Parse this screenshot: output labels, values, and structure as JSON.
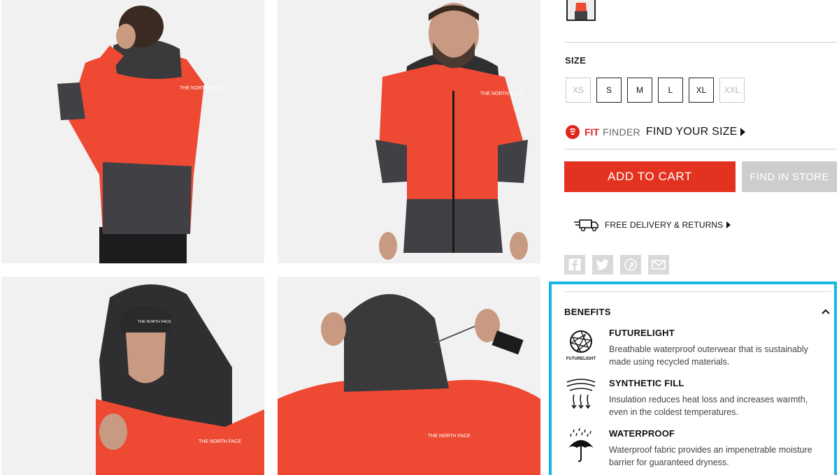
{
  "size": {
    "heading": "SIZE",
    "options": [
      {
        "label": "XS",
        "available": false
      },
      {
        "label": "S",
        "available": true
      },
      {
        "label": "M",
        "available": true
      },
      {
        "label": "L",
        "available": true
      },
      {
        "label": "XL",
        "available": true
      },
      {
        "label": "XXL",
        "available": false
      }
    ]
  },
  "fit_finder": {
    "brand_strong": "FIT",
    "brand_light": "FINDER",
    "cta": "FIND YOUR SIZE"
  },
  "actions": {
    "add_to_cart": "ADD TO CART",
    "find_in_store": "FIND IN STORE"
  },
  "delivery": {
    "label": "FREE DELIVERY & RETURNS"
  },
  "social": [
    "facebook-icon",
    "twitter-icon",
    "pinterest-icon",
    "email-icon"
  ],
  "benefits": {
    "heading": "BENEFITS",
    "items": [
      {
        "title": "FUTURELIGHT",
        "icon_caption": "FUTURELIGHT",
        "icon": "futurelight-icon",
        "text": "Breathable waterproof outerwear that is sustainably made using recycled materials."
      },
      {
        "title": "SYNTHETIC FILL",
        "icon": "synthetic-fill-icon",
        "text": "Insulation reduces heat loss and increases warmth, even in the coldest temperatures."
      },
      {
        "title": "WATERPROOF",
        "icon": "umbrella-icon",
        "text": "Waterproof fabric provides an impenetrable moisture barrier for guaranteed dryness."
      }
    ]
  },
  "colors": {
    "accent_red": "#e3321f",
    "highlight_blue": "#19b4e6",
    "jacket_red": "#ee4a33",
    "jacket_dark": "#3b3a3d"
  }
}
